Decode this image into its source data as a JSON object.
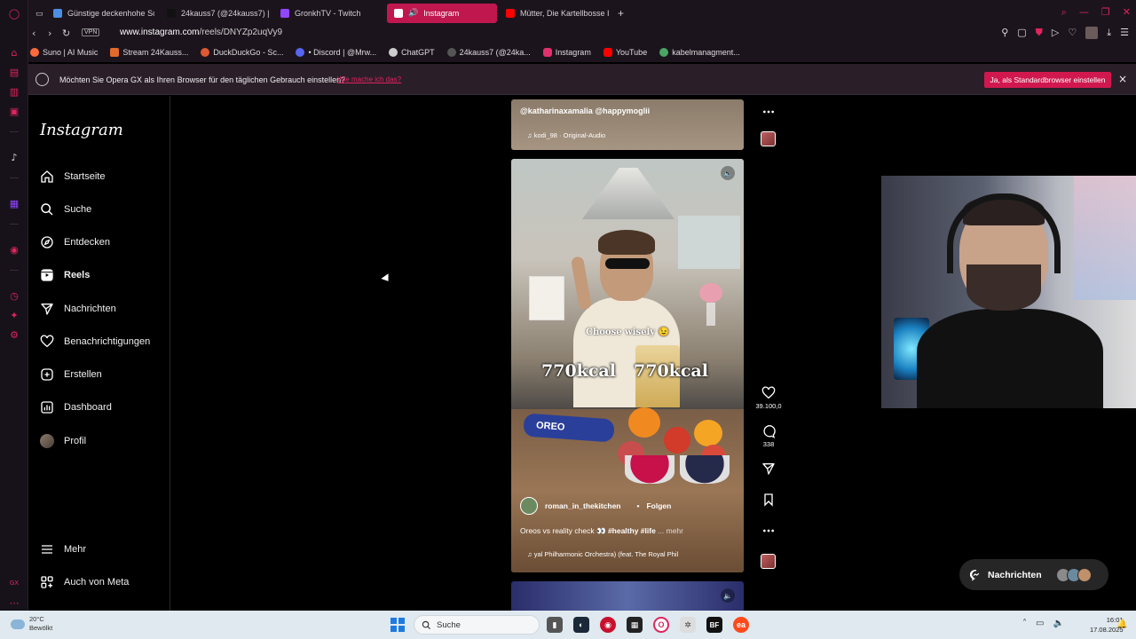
{
  "tabs": [
    {
      "label": "Günstige deckenhohe Sc",
      "fav_color": "#4a90e2"
    },
    {
      "label": "24kauss7 (@24kauss7) |",
      "fav_color": "#111111"
    },
    {
      "label": "GronkhTV - Twitch",
      "fav_color": "#9146ff"
    },
    {
      "label": "Instagram",
      "fav_color": "#e1306c",
      "active": true
    },
    {
      "label": "Mütter, Die Kartellbosse I",
      "fav_color": "#ff0000"
    }
  ],
  "address": {
    "vpn": "VPN",
    "host": "www.instagram.com",
    "path": "/reels/DNYZp2uqVy9"
  },
  "bookmarks": [
    {
      "label": "Suno | AI Music",
      "color": "#ff6a3d"
    },
    {
      "label": "Stream 24Kauss...",
      "color": "#e26a2c"
    },
    {
      "label": "DuckDuckGo - Sc...",
      "color": "#de5833"
    },
    {
      "label": "• Discord | @Mrw...",
      "color": "#5865f2"
    },
    {
      "label": "ChatGPT",
      "color": "#cccccc"
    },
    {
      "label": "24kauss7 (@24ka...",
      "color": "#111111"
    },
    {
      "label": "Instagram",
      "color": "#e1306c"
    },
    {
      "label": "YouTube",
      "color": "#ff0000"
    },
    {
      "label": "kabelmanagment...",
      "color": "#4aa564"
    }
  ],
  "infobar": {
    "text": "Möchten Sie Opera GX als Ihren Browser für den täglichen Gebrauch einstellen?",
    "link": "Wie mache ich das?",
    "button": "Ja, als Standardbrowser einstellen",
    "close": "×"
  },
  "sidebar": {
    "logo": "Instagram",
    "items": [
      {
        "label": "Startseite",
        "icon": "home-icon"
      },
      {
        "label": "Suche",
        "icon": "search-icon"
      },
      {
        "label": "Entdecken",
        "icon": "compass-icon"
      },
      {
        "label": "Reels",
        "icon": "reels-icon",
        "active": true
      },
      {
        "label": "Nachrichten",
        "icon": "send-icon"
      },
      {
        "label": "Benachrichtigungen",
        "icon": "heart-icon"
      },
      {
        "label": "Erstellen",
        "icon": "plus-square-icon"
      },
      {
        "label": "Dashboard",
        "icon": "dashboard-icon"
      },
      {
        "label": "Profil",
        "icon": "avatar"
      }
    ],
    "more": "Mehr",
    "meta": "Auch von Meta"
  },
  "prev_reel": {
    "caption": "@katharinaxamalia @happymoglii",
    "audio": "♫ kodi_98 · Original-Audio"
  },
  "reel": {
    "overlay_text": "Choose wisely 😉",
    "kcal_left": "770kcal",
    "kcal_right": "770kcal",
    "oreo": "OREO",
    "author": "roman_in_thekitchen",
    "follow": "Folgen",
    "dot": "•",
    "caption_text": "Oreos vs reality check 👀",
    "caption_tags": "#healthy #life",
    "caption_more": "... mehr",
    "audio": "♫ yal Philharmonic Orchestra) (feat. The Royal Phil"
  },
  "actions": {
    "likes": "39.100,0",
    "comments": "338"
  },
  "messages_pill": {
    "label": "Nachrichten"
  },
  "taskbar": {
    "temp": "20°C",
    "weather": "Bewölkt",
    "search": "Suche",
    "time": "16:01",
    "date": "17.08.2025"
  }
}
